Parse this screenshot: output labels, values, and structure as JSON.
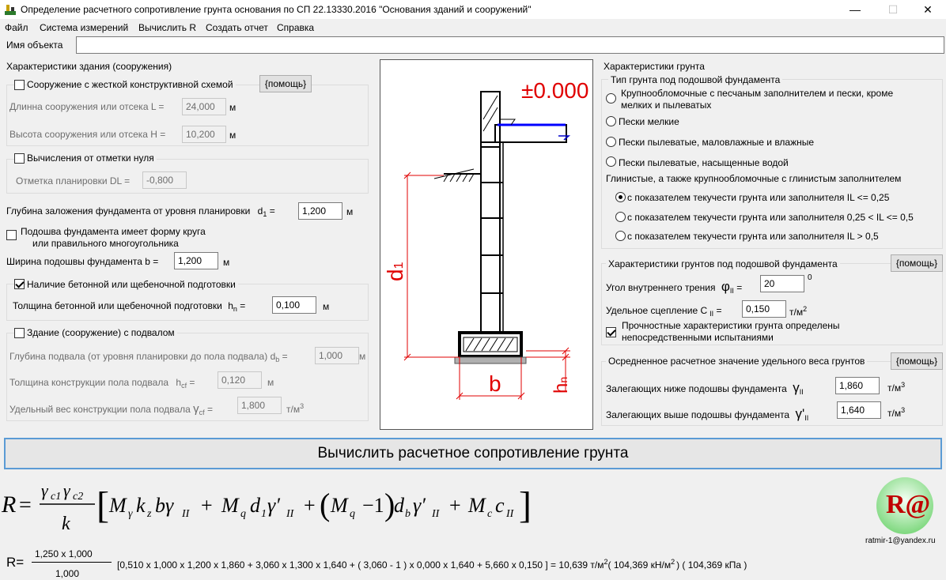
{
  "window": {
    "title": "Определение расчетного сопротивление грунта основания по СП 22.13330.2016  \"Основания зданий и сооружений\"",
    "minimize": "—",
    "maximize": "☐",
    "close": "✕"
  },
  "menu": [
    "Файл",
    "Система измерений",
    "Вычислить R",
    "Создать отчет",
    "Справка"
  ],
  "object": {
    "label": "Имя объекта",
    "value": ""
  },
  "building": {
    "title": "Характеристики  здания (сооружения)",
    "rigid": {
      "label": "Сооружение с жесткой конструктивной схемой",
      "checked": false,
      "help": "{помощь}"
    },
    "L": {
      "label": "Длинна сооружения или отсека L =",
      "value": "24,000",
      "unit": "м"
    },
    "H": {
      "label": "Высота сооружения или отсека H =",
      "value": "10,200",
      "unit": "м"
    },
    "zero": {
      "label": "Вычисления от отметки нуля",
      "checked": false
    },
    "DL": {
      "label": "Отметка планировки DL =",
      "value": "-0,800"
    },
    "d1": {
      "label": "Глубина заложения фундамента от уровня планировки",
      "sym": "d",
      "sub": "1",
      "eq": "=",
      "value": "1,200",
      "unit": "м"
    },
    "circle": {
      "label1": "Подошва фундамента имеет форму круга",
      "label2": "или правильного многоугольника",
      "checked": false
    },
    "b": {
      "label": "Ширина подошвы фундамента b =",
      "value": "1,200",
      "unit": "м"
    },
    "prep": {
      "label": "Наличие бетонной или щебеночной подготовки",
      "checked": true
    },
    "hn": {
      "label": "Толщина бетонной или щебеночной подготовки",
      "sym": "h",
      "sub": "n",
      "eq": "=",
      "value": "0,100",
      "unit": "м"
    },
    "basement": {
      "label": "Здание (сооружение) с подвалом",
      "checked": false
    },
    "db": {
      "label": "Глубина подвала (от уровня планировки до пола подвала)",
      "sym": "d",
      "sub": "b",
      "eq": "=",
      "value": "1,000",
      "unit": "м"
    },
    "hcf": {
      "label": "Толщина конструкции пола подвала",
      "sym": "h",
      "sub": "cf",
      "eq": "=",
      "value": "0,120",
      "unit": "м"
    },
    "gcf": {
      "label": "Удельный вес конструкции пола подвала",
      "sym": "γ",
      "sub": "cf",
      "eq": "=",
      "value": "1,800",
      "unit": "т/м",
      "unit_sup": "3"
    }
  },
  "drawing": {
    "level": "±0.000",
    "d1": "d",
    "d1_sub": "1",
    "b": "b",
    "hn": "h",
    "hn_sub": "n"
  },
  "soil": {
    "title": "Характеристики грунта",
    "type_title": "Тип грунта под подошвой фундамента",
    "opt1a": "Крупнообломочные с песчаным заполнителем и пески, кроме",
    "opt1b": "мелких и пылеватых",
    "opt2": "Пески мелкие",
    "opt3": "Пески пылеватые, маловлажные и влажные",
    "opt4": "Пески пылеватые, насыщенные водой",
    "clay_title": "Глинистые, а также крупнообломочные с глинистым заполнителем",
    "opt5": "с показателем текучести грунта или заполнителя IL <= 0,25",
    "opt6": "с показателем текучести грунта или заполнителя 0,25 < IL <= 0,5",
    "opt7": "с показателем текучести грунта или заполнителя IL > 0,5",
    "chars_title": "Характеристики грунтов под подошвой фундамента",
    "help": "{помощь}",
    "phi": {
      "label": "Угол внутреннего трения",
      "sym": "φ",
      "sub": "II",
      "eq": "=",
      "value": "20",
      "unit": "0"
    },
    "c": {
      "label": "Удельное сцепление  C",
      "sub": "II",
      "eq": "=",
      "value": "0,150",
      "unit": "т/м",
      "unit_sup": "2"
    },
    "tests": {
      "label1": "Прочностные характеристики грунта определены",
      "label2": "непосредственными испытаниями",
      "checked": true
    },
    "gamma_title": "Осредненное расчетное значение удельного веса грунтов",
    "help2": "{помощь}",
    "g_below": {
      "label": "Залегающих ниже подошвы фундамента",
      "sym": "γ",
      "sub": "II",
      "value": "1,860",
      "unit": "т/м",
      "unit_sup": "3"
    },
    "g_above": {
      "label": "Залегающих выше подошвы фундамента",
      "sym": "γ'",
      "sub": "II",
      "value": "1,640",
      "unit": "т/м",
      "unit_sup": "3"
    }
  },
  "calc_button": "Вычислить расчетное сопротивление грунта",
  "result": {
    "prefix": "R=",
    "numerator": "1,250 x 1,000",
    "denominator": "1,000",
    "expression": "[0,510 x 1,000 x 1,200 x 1,860 + 3,060 x 1,300 x 1,640 + ( 3,060 - 1 ) x 0,000 x 1,640 + 5,660 x 0,150 ] = 10,639 т/м",
    "sup1": "2",
    "kn": "( 104,369 кН/м",
    "sup2": "2",
    "kpa": ") ( 104,369 кПа )"
  },
  "logo": {
    "text": "R@",
    "email": "ratmir-1@yandex.ru"
  }
}
